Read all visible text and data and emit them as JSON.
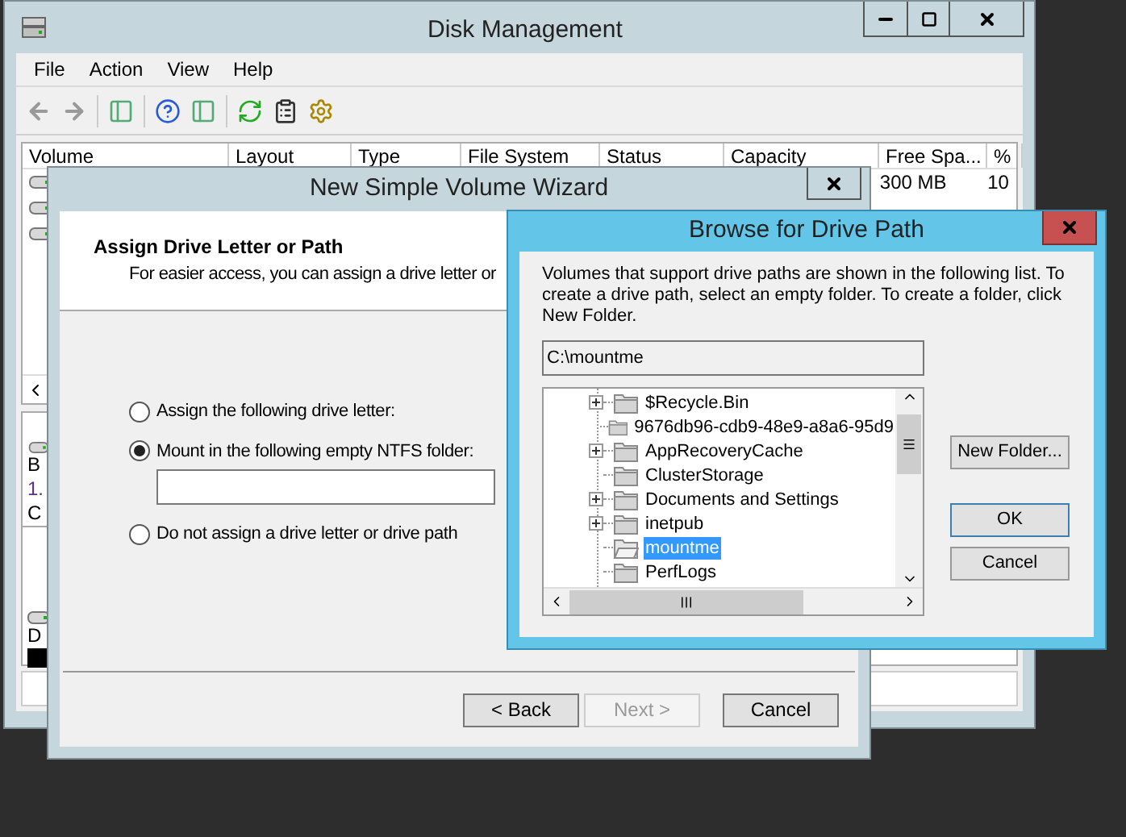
{
  "disk_management": {
    "title": "Disk Management",
    "menu": [
      "File",
      "Action",
      "View",
      "Help"
    ],
    "columns": [
      "Volume",
      "Layout",
      "Type",
      "File System",
      "Status",
      "Capacity",
      "Free Spa...",
      "%"
    ],
    "rows": [
      {
        "free_space": "300 MB",
        "percent_free": "10"
      },
      {},
      {}
    ],
    "lower_pane_labels": [
      "B",
      "1.",
      "C"
    ],
    "second_disk_label": "D"
  },
  "wizard": {
    "title": "New Simple Volume Wizard",
    "heading": "Assign Drive Letter or Path",
    "subheading": "For easier access, you can assign a drive letter or",
    "options": [
      {
        "label": "Assign the following drive letter:",
        "selected": false
      },
      {
        "label": "Mount in the following empty NTFS folder:",
        "selected": true,
        "has_field": true
      },
      {
        "label": "Do not assign a drive letter or drive path",
        "selected": false
      }
    ],
    "buttons": [
      {
        "label": "< Back",
        "disabled": false
      },
      {
        "label": "Next >",
        "disabled": true
      },
      {
        "label": "Cancel",
        "disabled": false
      }
    ]
  },
  "browse_dialog": {
    "title": "Browse for Drive Path",
    "description": "Volumes that support drive paths are shown in the following list. To create a drive path, select an empty folder. To create a folder, click New Folder.",
    "path": "C:\\mountme",
    "folders": [
      {
        "name": "$Recycle.Bin",
        "expandable": true,
        "selected": false
      },
      {
        "name": "9676db96-cdb9-48e9-a8a6-95d9",
        "expandable": false,
        "selected": false
      },
      {
        "name": "AppRecoveryCache",
        "expandable": true,
        "selected": false
      },
      {
        "name": "ClusterStorage",
        "expandable": false,
        "selected": false
      },
      {
        "name": "Documents and Settings",
        "expandable": true,
        "selected": false
      },
      {
        "name": "inetpub",
        "expandable": true,
        "selected": false
      },
      {
        "name": "mountme",
        "expandable": false,
        "selected": true
      },
      {
        "name": "PerfLogs",
        "expandable": false,
        "selected": false
      }
    ],
    "buttons": [
      {
        "label": "New Folder...",
        "focused": false
      },
      {
        "label": "OK",
        "focused": true
      },
      {
        "label": "Cancel",
        "focused": false
      }
    ]
  }
}
